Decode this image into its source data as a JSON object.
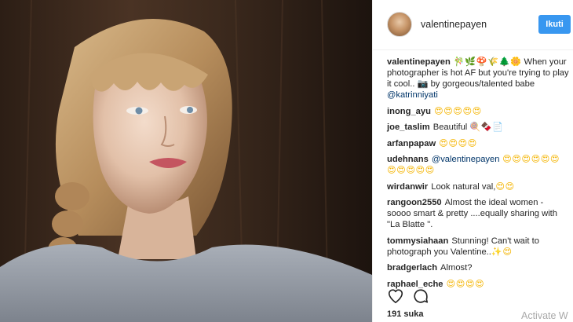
{
  "header": {
    "username": "valentinepayen",
    "follow_label": "Ikuti"
  },
  "caption": {
    "user": "valentinepayen",
    "emoji": "🎋🌿🍄🌾🌲🌼",
    "text": " When your photographer is hot AF but you're trying to play it cool.. 📷 by gorgeous/talented babe",
    "mention": "@katrinniyati"
  },
  "comments": [
    {
      "user": "inong_ayu",
      "text": "",
      "emoji": "😍😍😍😍😍"
    },
    {
      "user": "joe_taslim",
      "text": "Beautiful ",
      "emoji": "🍭🍫📄"
    },
    {
      "user": "arfanpapaw",
      "text": "",
      "emoji": "😍😍😍😍"
    },
    {
      "user": "udehnans",
      "mention": "@valentinepayen",
      "text": "",
      "emoji": " 😍😍😍😍😍😍😍😍😍😍😍"
    },
    {
      "user": "wirdanwir",
      "text": "Look natural val,",
      "emoji": "😍😍"
    },
    {
      "user": "rangoon2550",
      "text": "Almost the ideal women - soooo smart & pretty ....equally sharing with \"La Blatte \".",
      "emoji": ""
    },
    {
      "user": "tommysiahaan",
      "text": "Stunning! Can't wait to photograph you Valentine..",
      "emoji": "✨😍"
    },
    {
      "user": "bradgerlach",
      "text": "Almost?",
      "emoji": ""
    },
    {
      "user": "raphael_eche",
      "text": "",
      "emoji": "😍😍😍😍"
    }
  ],
  "footer": {
    "likes": "191 suka"
  },
  "icons": {
    "like": "heart-icon",
    "comment": "comment-icon"
  },
  "overlay": {
    "activate_text": "Activate W"
  }
}
